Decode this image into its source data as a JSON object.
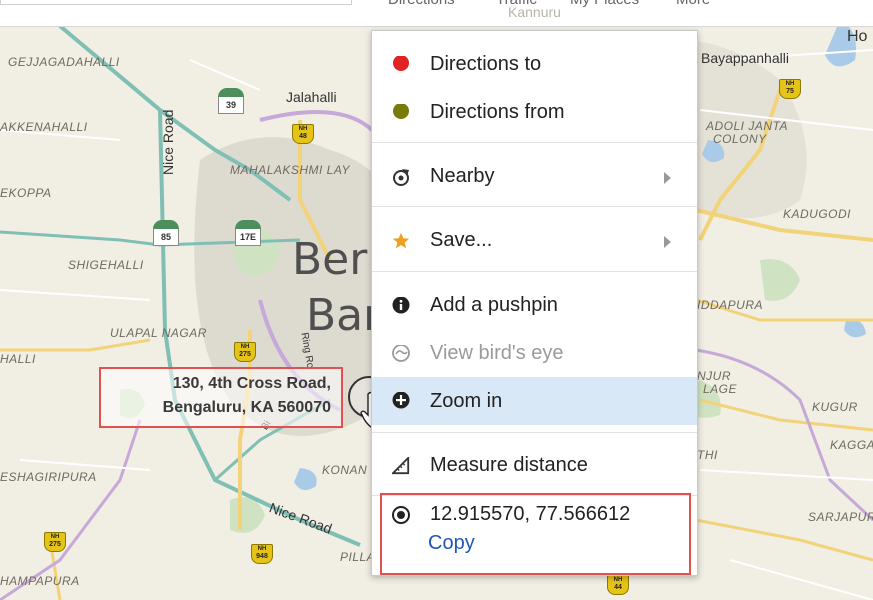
{
  "topbar": {
    "tabs": [
      "Directions",
      "Traffic",
      "My Places",
      "More"
    ],
    "overlay_text": "Kannuru"
  },
  "map": {
    "city_name_line1": "Ber",
    "city_name_line2": "Bar",
    "areas": [
      "GEJJAGADAHALLI",
      "AKKENAHALLI",
      "EKOPPA",
      "SHIGEHALLI",
      "ULAPAL NAGAR",
      "HALLI",
      "ESHAGIRIPURA",
      "HAMPAPURA",
      "MAHALAKSHMI LAY",
      "ADOLI JANTA",
      "COLONY",
      "KADUGODI",
      "IDDAPURA",
      "NJUR",
      "LAGE",
      "KUGUR",
      "KAGGA",
      "THI",
      "SARJAPUR",
      "KONAN",
      "PILLA"
    ],
    "towns": [
      "Jalahalli",
      "Bayappanhalli",
      "Ho"
    ],
    "roads": [
      "Nice Road",
      "Nice Road",
      "Bi",
      "Ring Ro"
    ],
    "highway_shields": [
      {
        "top": "NH",
        "num": "48"
      },
      {
        "top": "NH",
        "num": "75"
      },
      {
        "top": "NH",
        "num": "275"
      },
      {
        "top": "NH",
        "num": "275"
      },
      {
        "top": "NH",
        "num": "948"
      },
      {
        "top": "NH",
        "num": "44"
      }
    ],
    "state_badges": [
      "39",
      "85",
      "17E"
    ],
    "address_popup": {
      "line1": "130, 4th Cross Road,",
      "line2": "Bengaluru, KA 560070"
    }
  },
  "context_menu": {
    "directions_to": "Directions to",
    "directions_from": "Directions from",
    "nearby": "Nearby",
    "save": "Save...",
    "add_pushpin": "Add a pushpin",
    "view_birds_eye": "View bird's eye",
    "zoom_in": "Zoom in",
    "measure_distance": "Measure distance",
    "coordinates": "12.915570, 77.566612",
    "copy": "Copy"
  },
  "colors": {
    "directions_to_dot": "#e02424",
    "directions_from_dot": "#7a7a0a",
    "save_star": "#f0a020",
    "highlight": "#d9e8f6",
    "red_box": "#e0514f",
    "copy_link": "#1f57b4"
  }
}
